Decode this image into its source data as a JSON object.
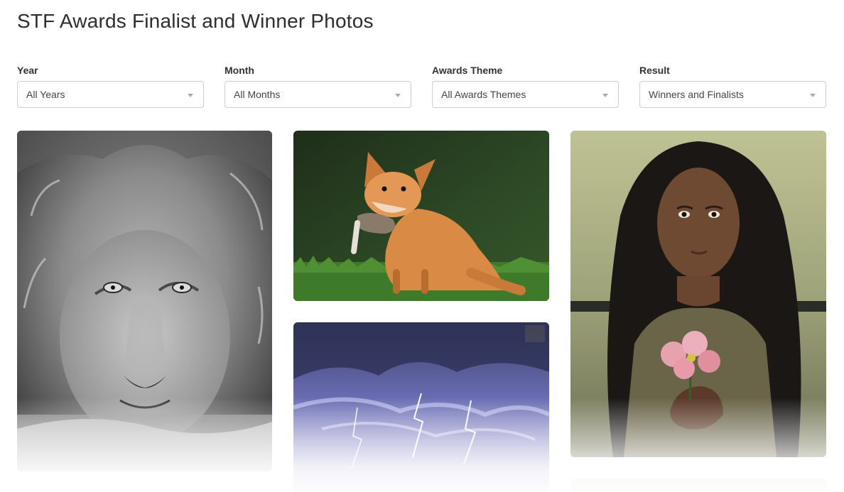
{
  "page": {
    "title": "STF Awards Finalist and Winner Photos"
  },
  "filters": {
    "year": {
      "label": "Year",
      "value": "All Years"
    },
    "month": {
      "label": "Month",
      "value": "All Months"
    },
    "theme": {
      "label": "Awards Theme",
      "value": "All Awards Themes"
    },
    "result": {
      "label": "Result",
      "value": "Winners and Finalists"
    }
  },
  "photos": [
    {
      "name": "lion-photo"
    },
    {
      "name": "fox-photo"
    },
    {
      "name": "storm-photo"
    },
    {
      "name": "woman-flower-photo"
    }
  ]
}
